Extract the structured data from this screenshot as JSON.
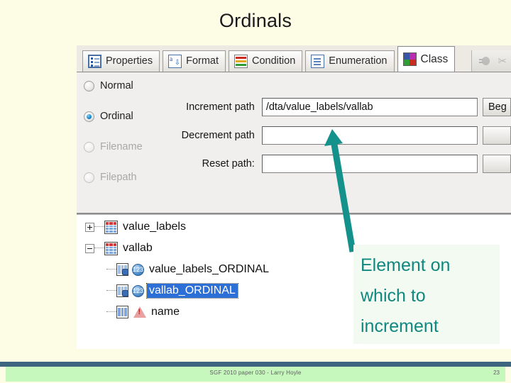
{
  "slide": {
    "title": "Ordinals",
    "page_number": "23",
    "footer_text": "SGF 2010 paper 030 - Larry Hoyle",
    "accent_color": "#10887f",
    "background_color": "#fdfde6",
    "footer_rule_color": "#3d6580",
    "footer_bar_color": "#c6f7bd"
  },
  "dialog": {
    "tabs": [
      {
        "label": "Properties",
        "icon": "properties-icon",
        "active": false
      },
      {
        "label": "Format",
        "icon": "format-icon",
        "active": false
      },
      {
        "label": "Condition",
        "icon": "condition-icon",
        "active": false
      },
      {
        "label": "Enumeration",
        "icon": "enumeration-icon",
        "active": false
      },
      {
        "label": "Class",
        "icon": "class-icon",
        "active": true
      }
    ],
    "toolbar_right": {
      "bug_icon": "bug-icon",
      "scissors_icon": "scissors-icon",
      "scissors_glyph": "✂"
    },
    "radio_options": [
      {
        "label": "Normal",
        "accesskey": "N",
        "selected": false,
        "disabled": false
      },
      {
        "label": "Ordinal",
        "accesskey": "O",
        "selected": true,
        "disabled": false
      },
      {
        "label": "Filename",
        "accesskey": "F",
        "selected": false,
        "disabled": true
      },
      {
        "label": "Filepath",
        "accesskey": "p",
        "selected": false,
        "disabled": true
      }
    ],
    "fields": [
      {
        "label": "Increment path",
        "value": "/dta/value_labels/vallab",
        "button": "Beg"
      },
      {
        "label": "Decrement path",
        "value": "",
        "button": ""
      },
      {
        "label": "Reset path:",
        "value": "",
        "button": ""
      }
    ]
  },
  "tree": {
    "nodes": [
      {
        "label": "value_labels",
        "expander": "plus",
        "icon": "grid-icon",
        "level": 0,
        "selected": false,
        "type": "grid"
      },
      {
        "label": "vallab",
        "expander": "minus",
        "icon": "grid-icon",
        "level": 0,
        "selected": false,
        "type": "grid"
      },
      {
        "label": "value_labels_ORDINAL",
        "expander": "none",
        "icon": "piece-icon",
        "badge": "123",
        "level": 1,
        "selected": false,
        "type": "ordinal"
      },
      {
        "label": "vallab_ORDINAL",
        "expander": "none",
        "icon": "piece-icon",
        "badge": "123",
        "level": 1,
        "selected": true,
        "type": "ordinal"
      },
      {
        "label": "name",
        "expander": "none",
        "icon": "column-icon",
        "level": 1,
        "selected": false,
        "type": "warning"
      }
    ]
  },
  "annotation": {
    "callout_line_1": "Element on",
    "callout_line_2": "which to",
    "callout_line_3": "increment",
    "arrow_name": "increment-path-pointer-arrow",
    "arrow_color": "#13918a"
  }
}
